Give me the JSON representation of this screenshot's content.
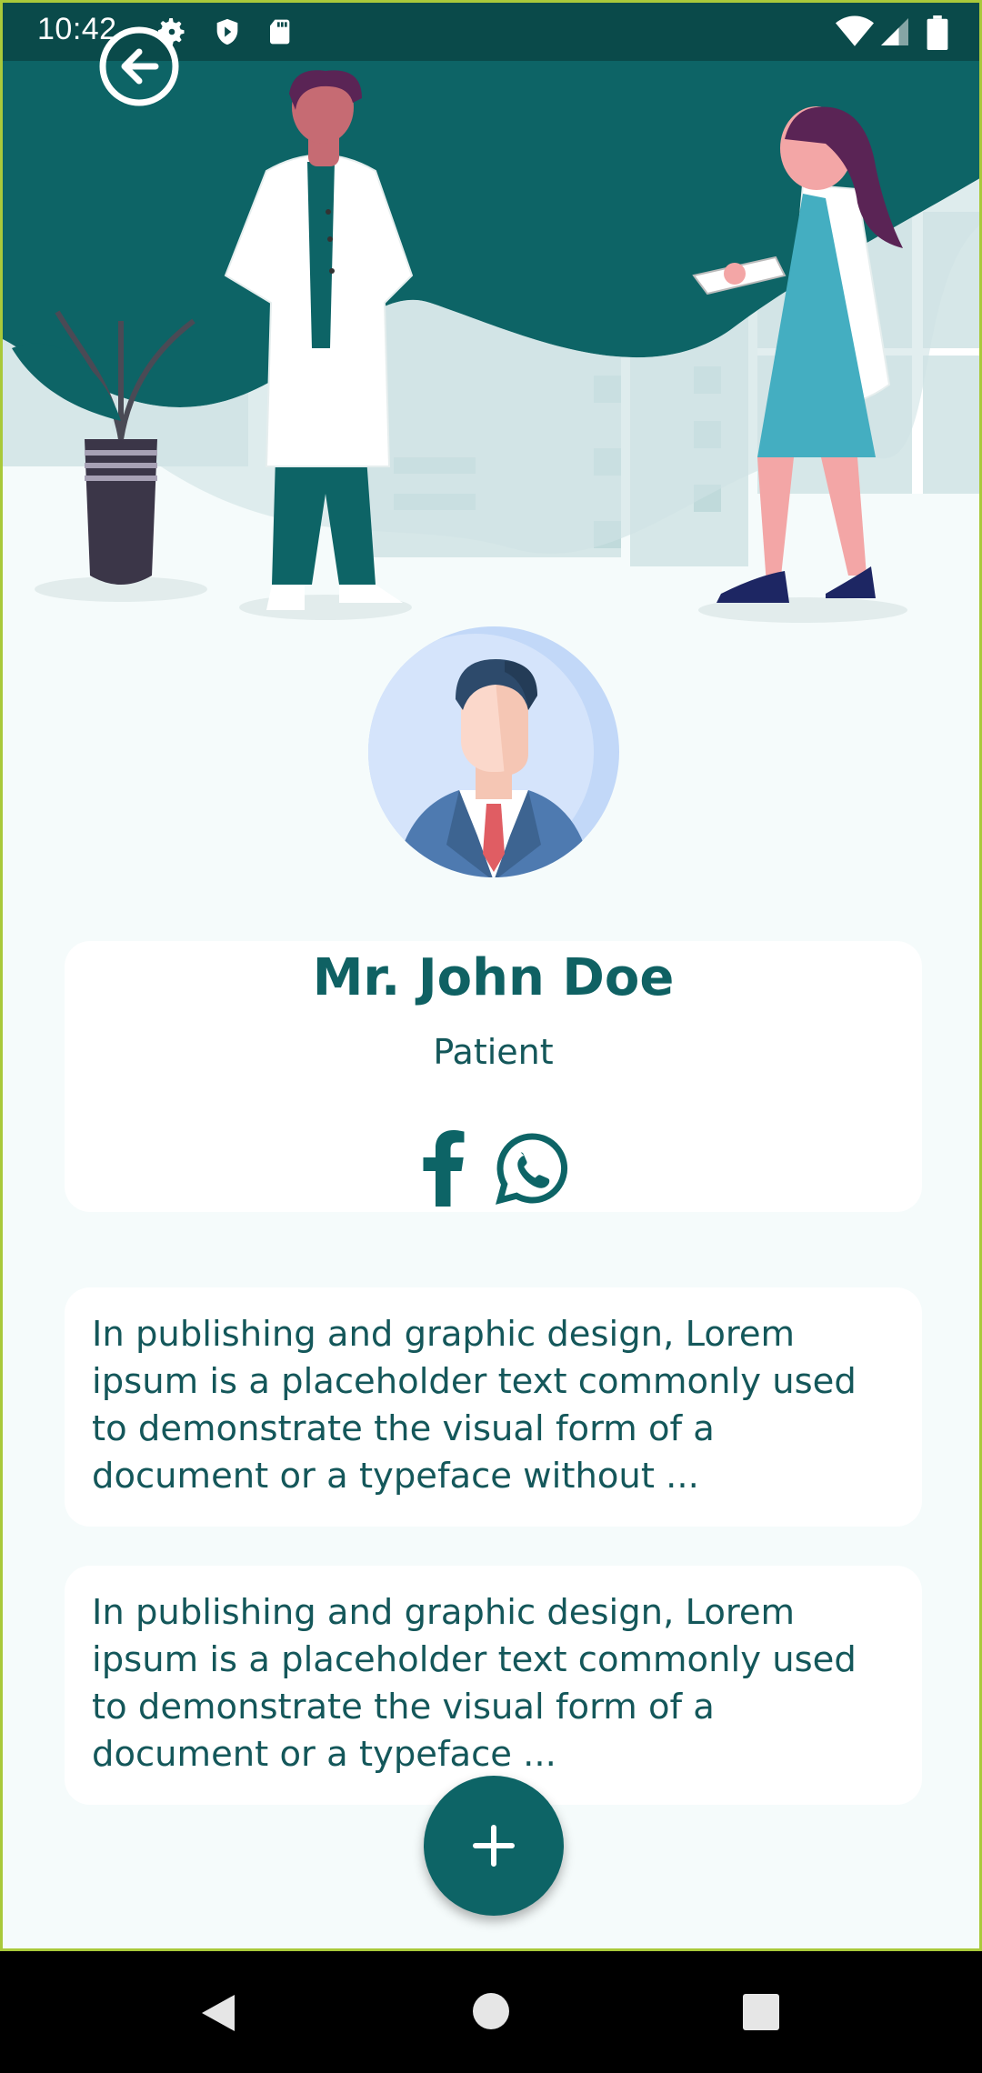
{
  "status_bar": {
    "time": "10:42",
    "icons": [
      "settings-icon",
      "shield-icon",
      "sd-card-icon",
      "wifi-icon",
      "signal-icon",
      "battery-icon"
    ]
  },
  "header": {
    "back_icon": "back-arrow-icon",
    "illustration": "doctors-illustration"
  },
  "profile": {
    "avatar": "man-in-suit-avatar",
    "name": "Mr. John Doe",
    "role": "Patient",
    "social": [
      {
        "name": "facebook-icon"
      },
      {
        "name": "whatsapp-icon"
      }
    ]
  },
  "cards": [
    {
      "text": "In publishing and graphic design, Lorem ipsum is a placeholder text commonly used to demonstrate the visual form of a document or a typeface without ..."
    },
    {
      "text": "In publishing and graphic design, Lorem ipsum is a placeholder text commonly used to demonstrate the visual form of a document or a typeface  ..."
    }
  ],
  "fab": {
    "icon": "plus-icon"
  },
  "nav_bar": {
    "buttons": [
      "back-triangle-icon",
      "home-circle-icon",
      "recents-square-icon"
    ]
  },
  "colors": {
    "primary": "#0d6466",
    "text": "#14575a",
    "background": "#f5fbfb",
    "card": "#ffffff",
    "status_bar": "#0a4a4a"
  }
}
